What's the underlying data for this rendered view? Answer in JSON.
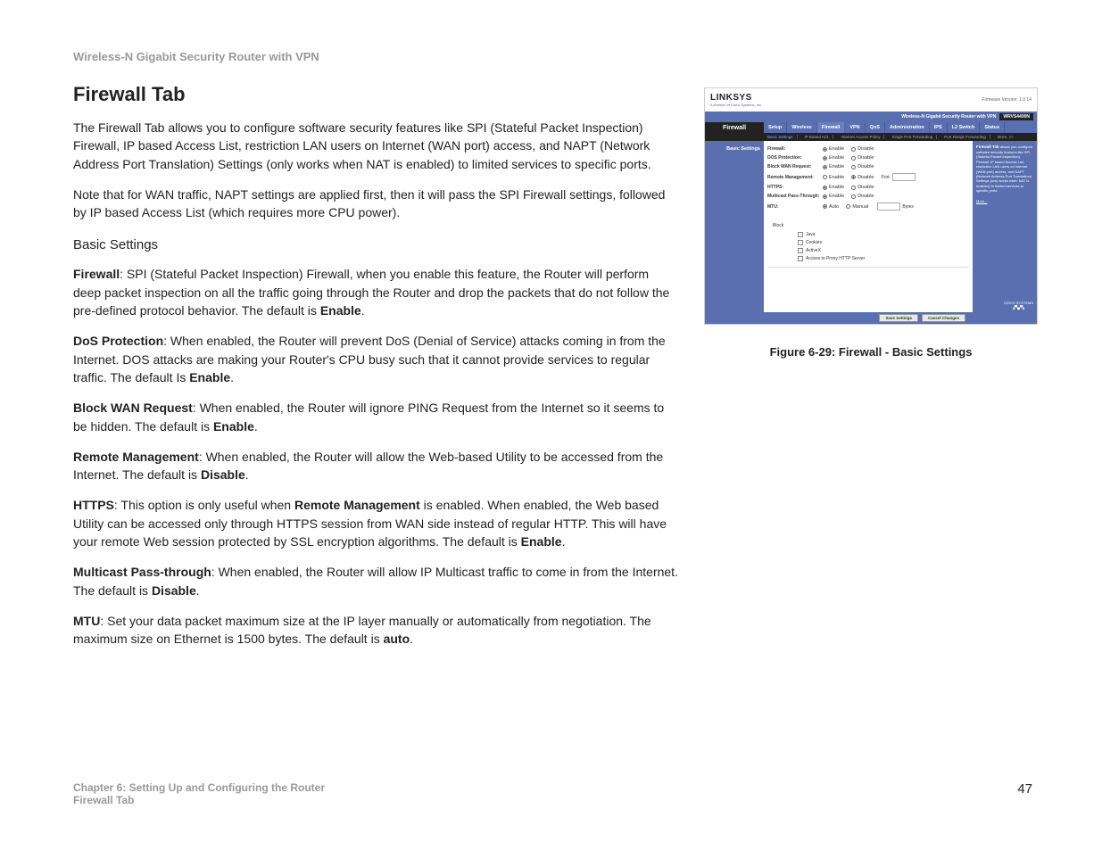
{
  "header": "Wireless-N Gigabit Security Router with VPN",
  "title": "Firewall Tab",
  "p1": "The Firewall Tab allows you to configure software security features like SPI (Stateful Packet Inspection) Firewall, IP based Access List, restriction LAN users on Internet (WAN port) access, and NAPT (Network Address Port Translation) Settings (only works when NAT is enabled) to limited services to specific ports.",
  "p2": "Note that for WAN traffic, NAPT settings are applied first, then it will pass the SPI Firewall settings, followed by IP based Access List (which requires more CPU power).",
  "sub": "Basic Settings",
  "items": {
    "firewall": {
      "label": "Firewall",
      "text": ": SPI (Stateful Packet Inspection) Firewall, when you enable this feature, the Router will perform deep packet inspection on all the traffic going through the Router and drop the packets that do not follow the pre-defined protocol behavior. The default is ",
      "def": "Enable",
      "end": "."
    },
    "dos": {
      "label": "DoS Protection",
      "text": ": When enabled, the Router will prevent DoS (Denial of Service) attacks coming in from the Internet. DOS attacks are making your Router's CPU busy such that it cannot provide services to regular traffic. The default Is ",
      "def": "Enable",
      "end": "."
    },
    "block": {
      "label": "Block WAN Request",
      "text": ": When enabled, the Router will ignore PING Request from the Internet so it seems to be hidden. The default is ",
      "def": "Enable",
      "end": "."
    },
    "remote": {
      "label": "Remote Management",
      "text": ": When enabled, the Router will allow the Web-based Utility to be accessed from the Internet. The default is ",
      "def": "Disable",
      "end": "."
    },
    "https": {
      "label": "HTTPS",
      "text1": ": This option is only useful when ",
      "rm": "Remote Management",
      "text2": " is enabled. When enabled, the Web based Utility can be accessed only through HTTPS session from WAN side instead of regular HTTP. This will have your remote Web session protected by SSL encryption algorithms. The default is ",
      "def": "Enable",
      "end": "."
    },
    "multicast": {
      "label": "Multicast Pass-through",
      "text": ": When enabled, the Router will allow IP Multicast traffic to come in from the Internet. The default is ",
      "def": "Disable",
      "end": "."
    },
    "mtu": {
      "label": "MTU",
      "text": ": Set your data packet maximum size at the IP layer manually or automatically from negotiation. The maximum size on Ethernet is 1500 bytes. The default is ",
      "def": "auto",
      "end": "."
    }
  },
  "figure_caption": "Figure 6-29: Firewall - Basic Settings",
  "footer": {
    "chapter": "Chapter 6: Setting Up and Configuring the Router",
    "section": "Firewall Tab",
    "page": "47"
  },
  "ss": {
    "logo": "LINKSYS",
    "logo_sub": "A Division of Cisco Systems, Inc.",
    "fw": "Firmware Version: 1.0.14",
    "product": "Wireless-N Gigabit Security Router with VPN",
    "model": "WRVS4400N",
    "main_tab": "Firewall",
    "tabs": [
      "Setup",
      "Wireless",
      "Firewall",
      "VPN",
      "QoS",
      "Administration",
      "IPS",
      "L2 Switch",
      "Status"
    ],
    "subtabs": [
      "Basic Settings",
      "IP Based ACL",
      "Internet Access Policy",
      "Single Port Forwarding",
      "Port Range Forwarding",
      "More..>>"
    ],
    "sidebar_section": "Basic Settings",
    "rows": {
      "firewall": "Firewall:",
      "dos": "DOS Protection:",
      "block": "Block WAN Request:",
      "remote": "Remote Management:",
      "https": "HTTPS:",
      "multicast": "Multicast Pass-Through:",
      "mtu": "MTU:"
    },
    "radio": {
      "enable": "Enable",
      "disable": "Disable",
      "auto": "Auto",
      "manual": "Manual"
    },
    "port_label": "Port:",
    "bytes": "Bytes",
    "block": "Block",
    "cb": {
      "java": "Java",
      "cookies": "Cookies",
      "activex": "ActiveX",
      "proxy": "Access to Proxy HTTP Server"
    },
    "help_title": "Firewall Tab",
    "help_text": "allows you configure software security features like SPI (Stateful Packet Inspection) Firewall, IP based Access List, restriction LAN users on Internet (WAN port) access, and NAPT (Network Address Port Translation) Settings (only works when NAT is enabled) to limited services to specific ports.",
    "more": "More...",
    "btn_save": "Save Settings",
    "btn_cancel": "Cancel Changes",
    "cisco": "CISCO SYSTEMS"
  }
}
